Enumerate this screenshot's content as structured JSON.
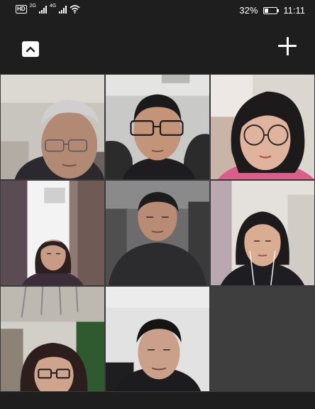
{
  "status_bar": {
    "hd_label": "HD",
    "network_1": "2G",
    "network_2": "4G",
    "battery_percent": "32%",
    "battery_level": 0.32,
    "time": "11:11",
    "icons": [
      "hd-icon",
      "signal-icon",
      "wifi-icon",
      "battery-icon"
    ]
  },
  "toolbar": {
    "collapse_icon": "chevron-up-icon",
    "add_icon": "plus-icon"
  },
  "participants": [
    {
      "id": "p1",
      "scene": "grey-haired man with glasses"
    },
    {
      "id": "p2",
      "scene": "young man with glasses in car"
    },
    {
      "id": "p3",
      "scene": "young woman with round glasses"
    },
    {
      "id": "p4",
      "scene": "woman by window with curtains"
    },
    {
      "id": "p5",
      "scene": "middle-aged man in dark jacket in car"
    },
    {
      "id": "p6",
      "scene": "young woman with earphones"
    },
    {
      "id": "p7",
      "scene": "woman with glasses under ceiling lights"
    },
    {
      "id": "p8",
      "scene": "man in dark jacket"
    }
  ],
  "colors": {
    "background": "#1e1e1e",
    "empty_tile": "#3e3e3e",
    "foreground": "#ffffff"
  }
}
